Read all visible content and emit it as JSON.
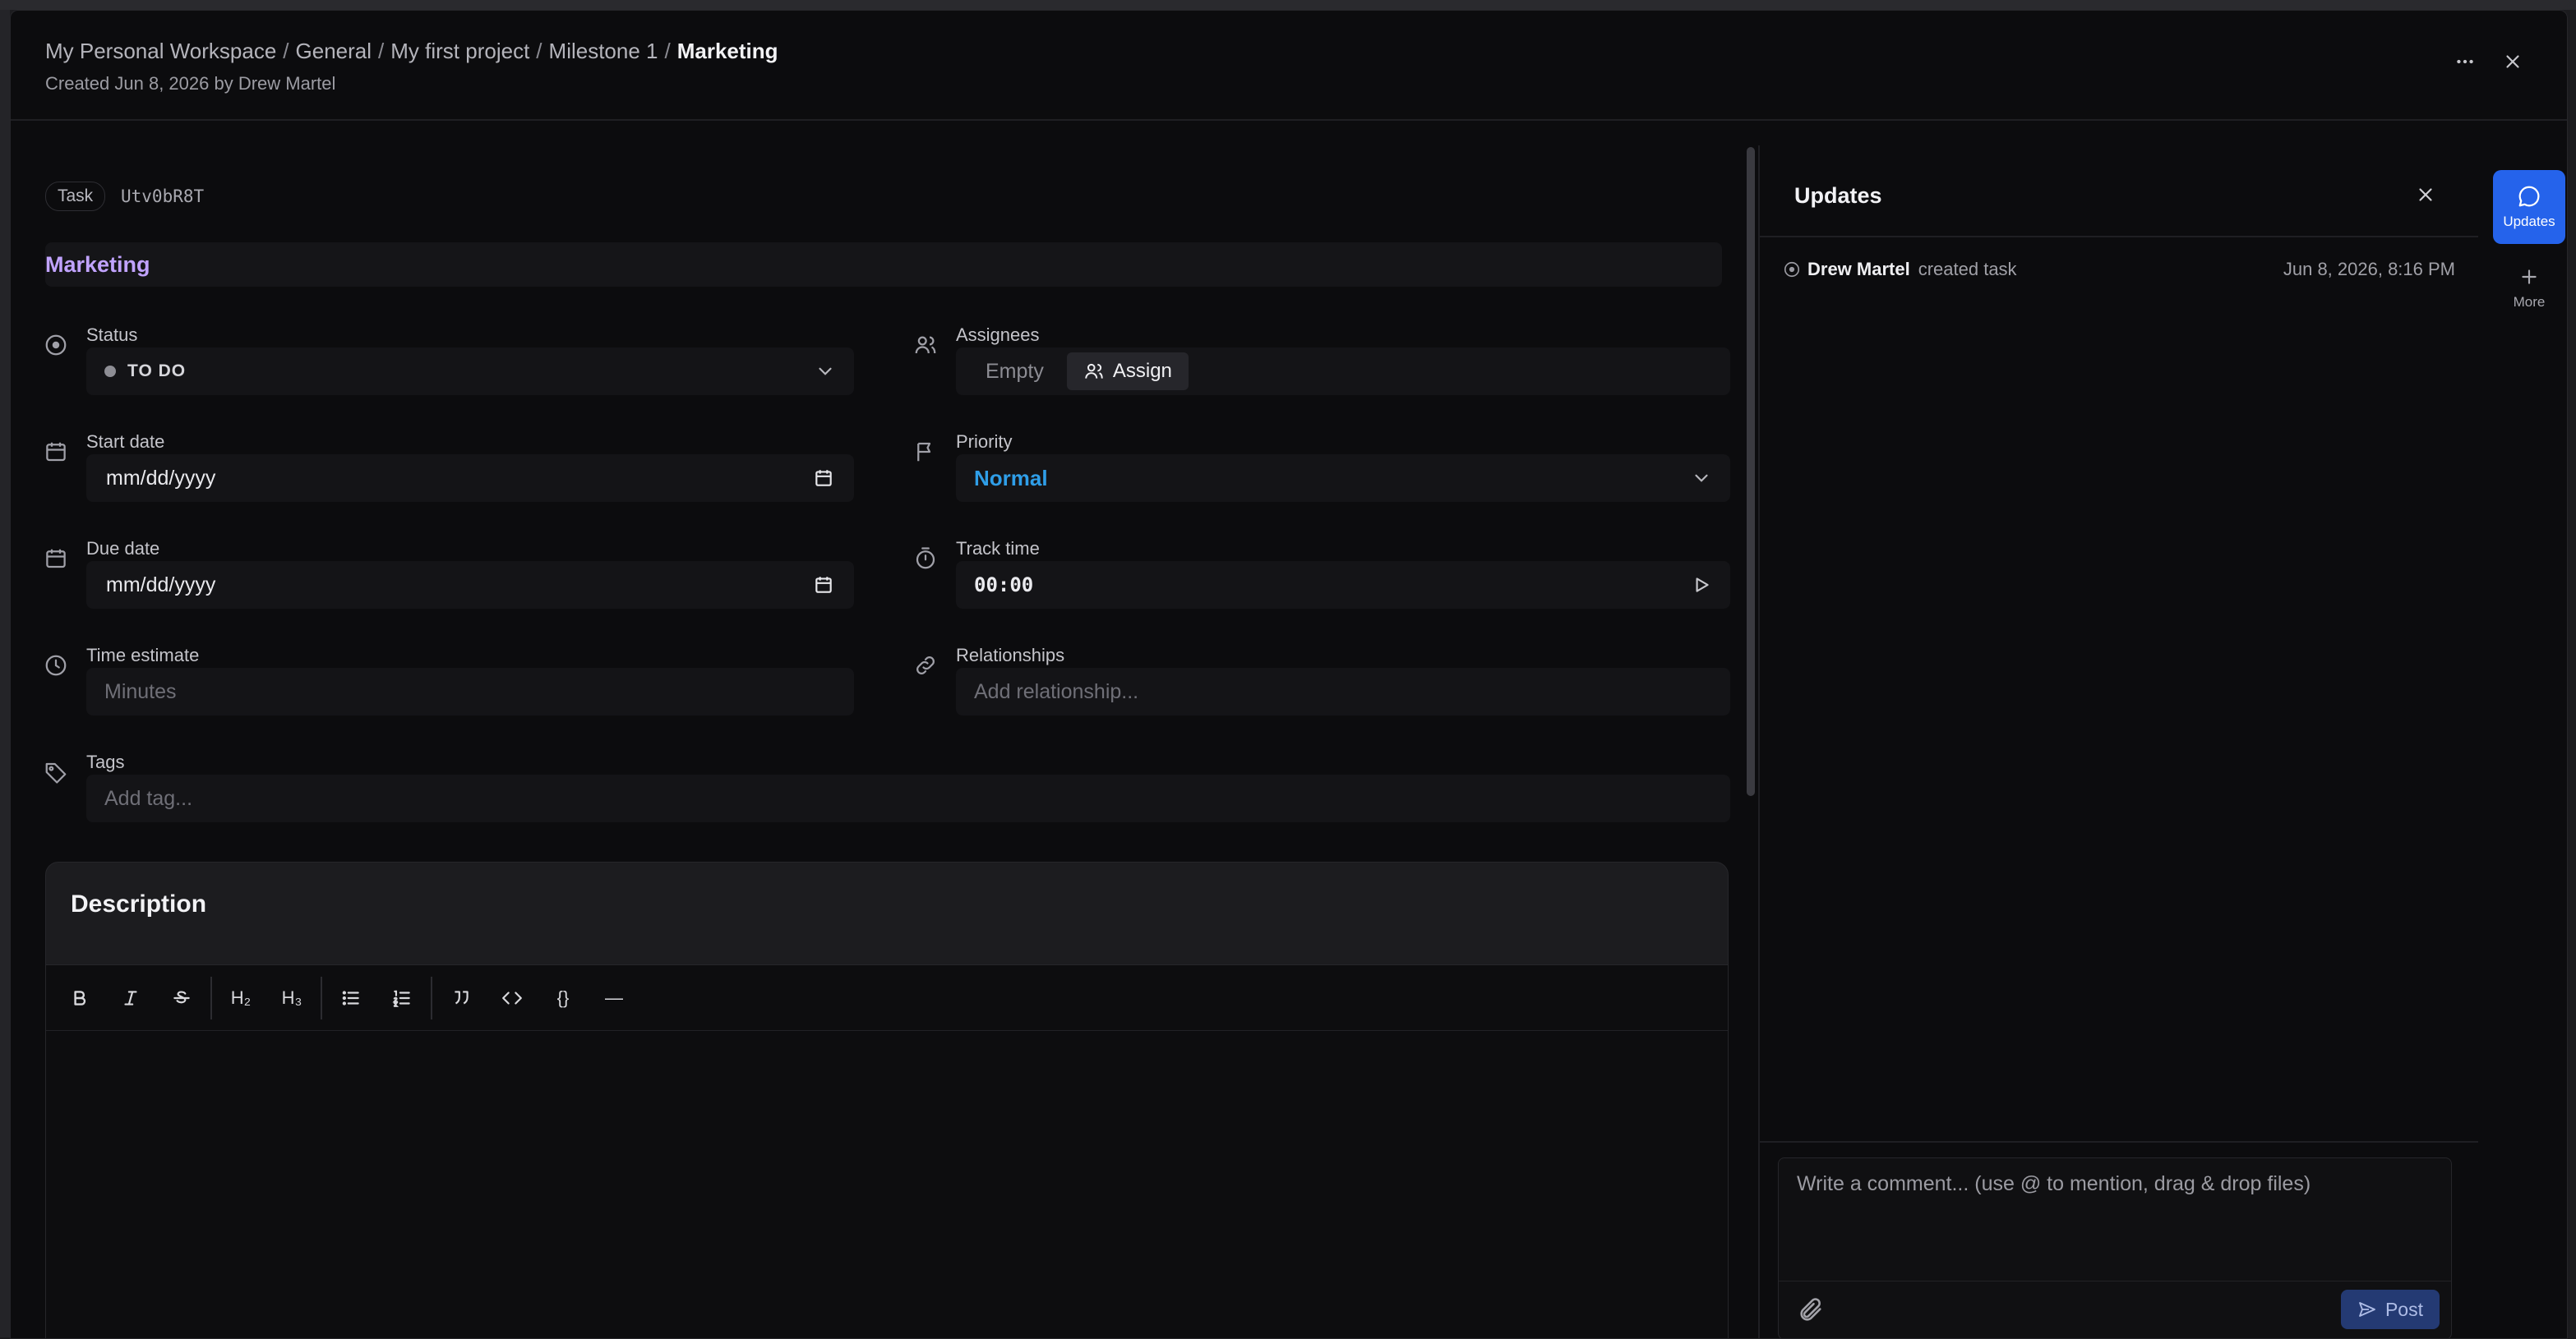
{
  "breadcrumb": {
    "items": [
      "My Personal Workspace",
      "General",
      "My first project",
      "Milestone 1"
    ],
    "separator": "/",
    "current": "Marketing"
  },
  "created_meta": "Created Jun 8, 2026 by Drew Martel",
  "task": {
    "type_chip": "Task",
    "id": "Utv0bR8T",
    "title": "Marketing"
  },
  "fields": {
    "status": {
      "label": "Status",
      "value": "TO DO"
    },
    "assignees": {
      "label": "Assignees",
      "empty_label": "Empty",
      "assign_label": "Assign"
    },
    "start_date": {
      "label": "Start date",
      "value": "mm/dd/yyyy"
    },
    "priority": {
      "label": "Priority",
      "value": "Normal"
    },
    "due_date": {
      "label": "Due date",
      "value": "mm/dd/yyyy"
    },
    "track_time": {
      "label": "Track time",
      "value": "00:00"
    },
    "time_estimate": {
      "label": "Time estimate",
      "placeholder": "Minutes"
    },
    "relationships": {
      "label": "Relationships",
      "placeholder": "Add relationship..."
    },
    "tags": {
      "label": "Tags",
      "placeholder": "Add tag..."
    }
  },
  "description": {
    "title": "Description",
    "toolbar": [
      "bold",
      "italic",
      "strikethrough",
      "H2",
      "H3",
      "bullet-list",
      "ordered-list",
      "blockquote",
      "code",
      "code-block",
      "horizontal-rule"
    ],
    "toolbar_labels": {
      "h2": "H₂",
      "h3": "H₃",
      "code_block": "{}",
      "hr": "—"
    }
  },
  "updates": {
    "title": "Updates",
    "activity": [
      {
        "user": "Drew Martel",
        "action": "created task",
        "timestamp": "Jun 8, 2026, 8:16 PM"
      }
    ],
    "comment_placeholder": "Write a comment... (use @ to mention, drag & drop files)",
    "post_label": "Post"
  },
  "rail": {
    "updates_label": "Updates",
    "more_label": "More"
  },
  "colors": {
    "accent": "#2563eb",
    "title": "#c1a3ff",
    "priority": "#2f9ee8",
    "background": "#0c0c0e"
  }
}
